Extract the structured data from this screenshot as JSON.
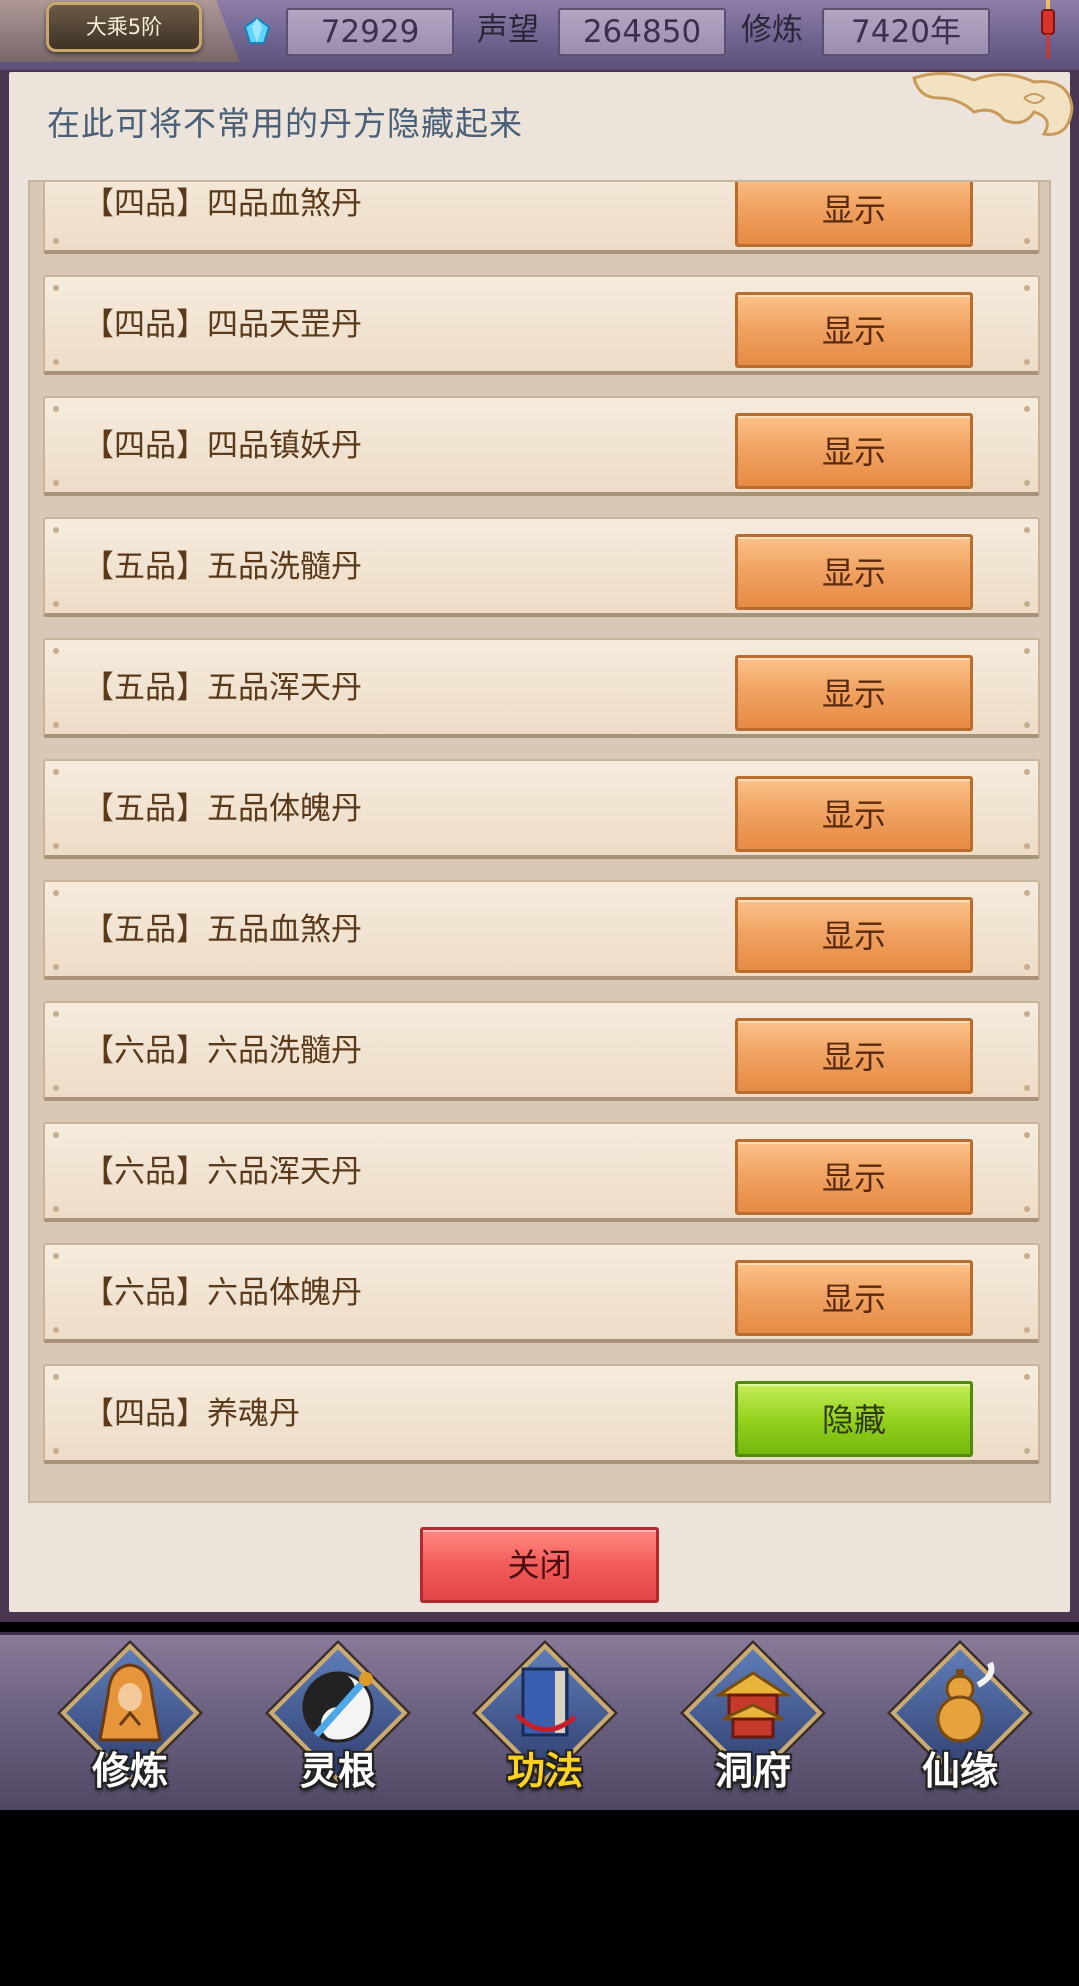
{
  "top_bar": {
    "realm": "大乘5阶",
    "gems": "72929",
    "reputation_label": "声望",
    "reputation": "264850",
    "cultivation_label": "修炼",
    "cultivation": "7420年"
  },
  "dialog": {
    "hint": "在此可将不常用的丹方隐藏起来",
    "recipes": [
      {
        "label": "【四品】四品血煞丹",
        "action": "显示",
        "state": "hidden"
      },
      {
        "label": "【四品】四品天罡丹",
        "action": "显示",
        "state": "hidden"
      },
      {
        "label": "【四品】四品镇妖丹",
        "action": "显示",
        "state": "hidden"
      },
      {
        "label": "【五品】五品洗髓丹",
        "action": "显示",
        "state": "hidden"
      },
      {
        "label": "【五品】五品浑天丹",
        "action": "显示",
        "state": "hidden"
      },
      {
        "label": "【五品】五品体魄丹",
        "action": "显示",
        "state": "hidden"
      },
      {
        "label": "【五品】五品血煞丹",
        "action": "显示",
        "state": "hidden"
      },
      {
        "label": "【六品】六品洗髓丹",
        "action": "显示",
        "state": "hidden"
      },
      {
        "label": "【六品】六品浑天丹",
        "action": "显示",
        "state": "hidden"
      },
      {
        "label": "【六品】六品体魄丹",
        "action": "显示",
        "state": "hidden"
      },
      {
        "label": "【四品】养魂丹",
        "action": "隐藏",
        "state": "shown"
      }
    ],
    "close_label": "关闭"
  },
  "bottom_nav": {
    "items": [
      {
        "label": "修炼",
        "icon": "cultivator-icon",
        "active": false
      },
      {
        "label": "灵根",
        "icon": "spirit-root-icon",
        "active": false
      },
      {
        "label": "功法",
        "icon": "technique-book-icon",
        "active": true
      },
      {
        "label": "洞府",
        "icon": "cave-dwelling-icon",
        "active": false
      },
      {
        "label": "仙缘",
        "icon": "gourd-icon",
        "active": false
      }
    ]
  },
  "colors": {
    "show_button": "#f0a160",
    "hide_button": "#95d21e",
    "close_button": "#f25c5a",
    "active_nav": "#ffd21f"
  }
}
